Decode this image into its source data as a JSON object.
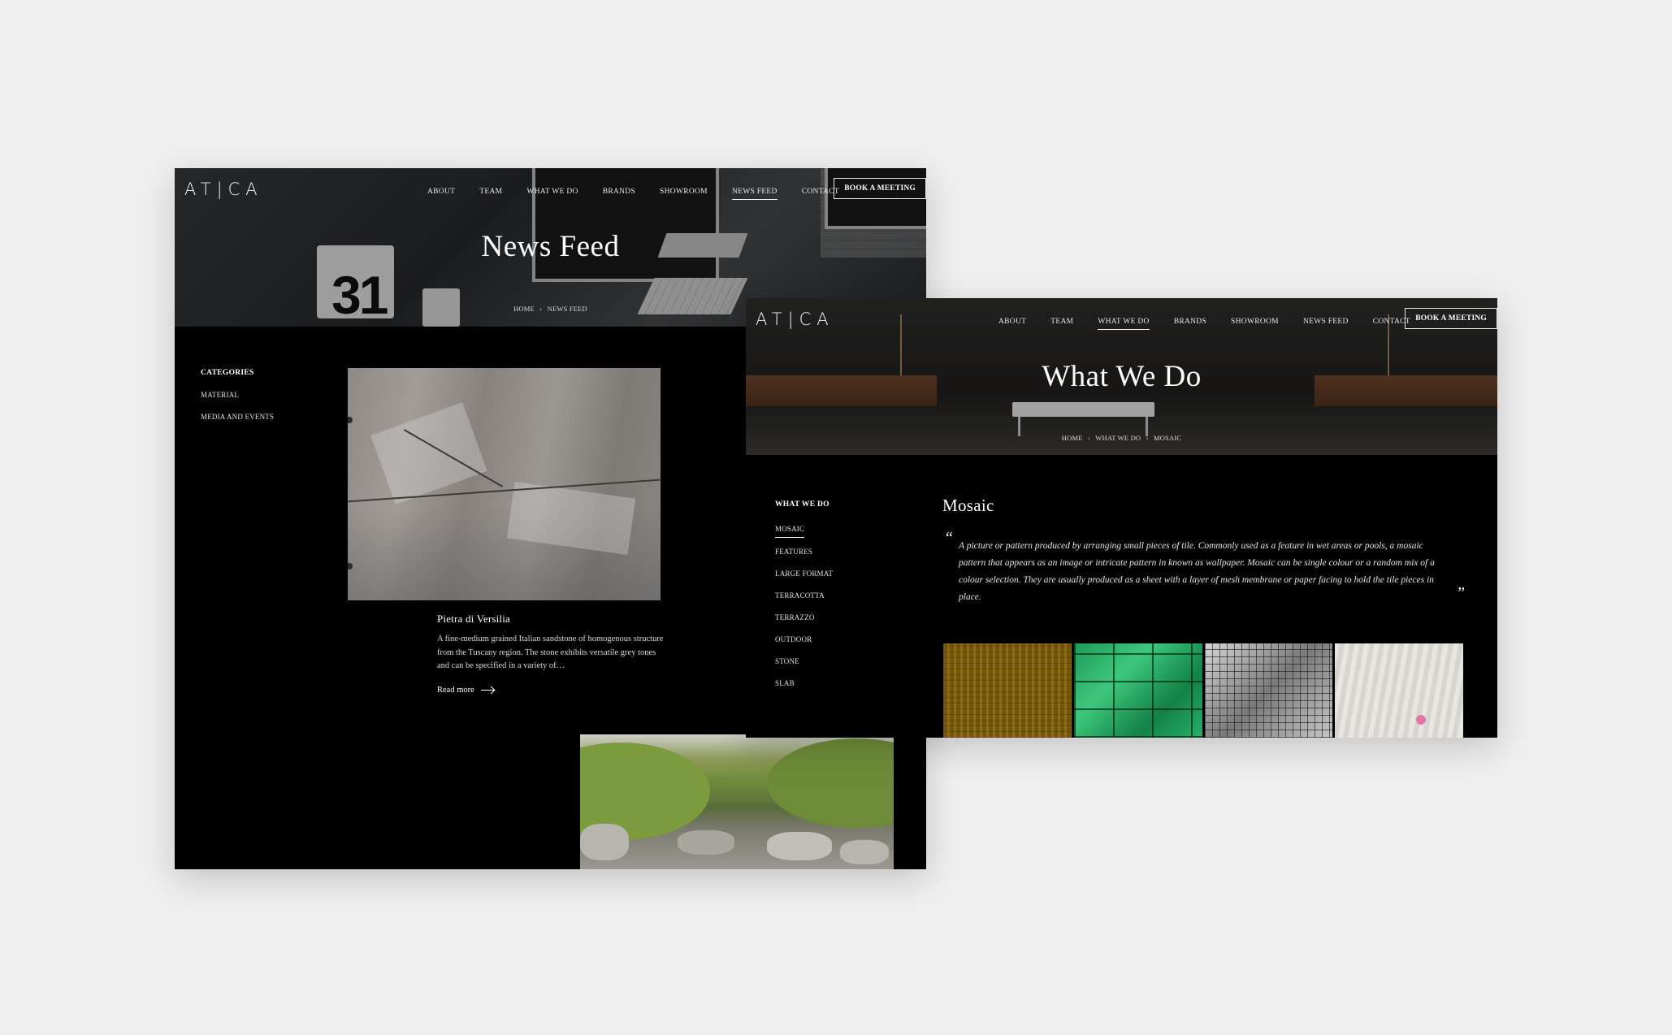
{
  "brand": {
    "logo": "AT|CA"
  },
  "nav": {
    "items": [
      "ABOUT",
      "TEAM",
      "WHAT WE DO",
      "BRANDS",
      "SHOWROOM",
      "NEWS FEED",
      "CONTACT"
    ],
    "cta": "BOOK A MEETING"
  },
  "news_page": {
    "active_nav": "NEWS FEED",
    "title": "News Feed",
    "breadcrumb": [
      "HOME",
      "NEWS FEED"
    ],
    "categories": {
      "heading": "CATEGORIES",
      "items": [
        "MATERIAL",
        "MEDIA AND EVENTS"
      ]
    },
    "article": {
      "title": "Pietra di Versilia",
      "excerpt": "A fine-medium grained Italian sandstone of homogenous structure from the Tuscany region. The stone exhibits versatile grey tones and can be specified in a variety of…",
      "read_more": "Read more"
    },
    "calendar_number": "31"
  },
  "what_page": {
    "active_nav": "WHAT WE DO",
    "title": "What We Do",
    "breadcrumb": [
      "HOME",
      "WHAT WE DO",
      "MOSAIC"
    ],
    "sidebar": {
      "heading": "WHAT WE DO",
      "items": [
        "MOSAIC",
        "FEATURES",
        "LARGE FORMAT",
        "TERRACOTTA",
        "TERRAZZO",
        "OUTDOOR",
        "STONE",
        "SLAB"
      ],
      "active": "MOSAIC"
    },
    "section_title": "Mosaic",
    "quote_open": "“",
    "quote_close": "”",
    "quote": "A picture or pattern produced by arranging small pieces of tile. Commonly used as a feature in wet areas or pools, a mosaic pattern that appears as an image or intricate pattern in known as wallpaper. Mosaic can be single colour or a random mix of a colour selection. They are usually produced as a sheet with a layer of mesh membrane or paper facing to hold the tile pieces in place."
  },
  "colors": {
    "background": "#efefef",
    "page": "#000000",
    "text": "#ffffff"
  }
}
